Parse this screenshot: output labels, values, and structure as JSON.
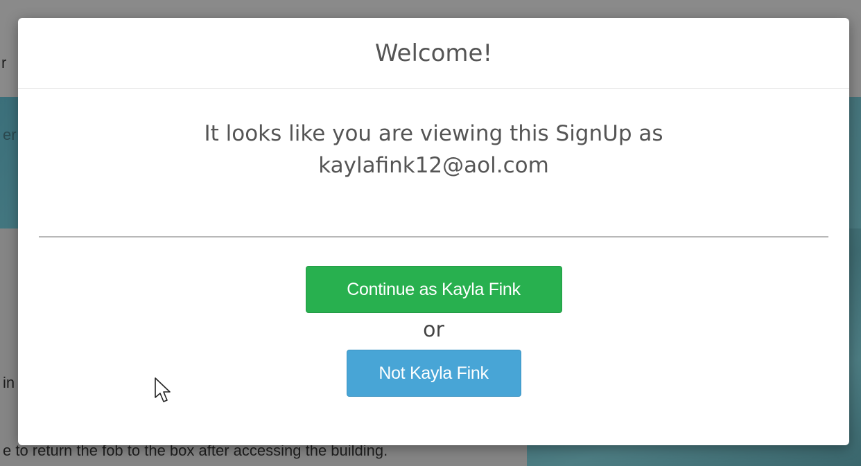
{
  "background": {
    "fragment_1": "r",
    "fragment_2": "er",
    "fragment_3": "in",
    "fragment_4": "e to return the fob to the box after accessing the building."
  },
  "modal": {
    "title": "Welcome!",
    "message_line_1": "It looks like you are viewing this SignUp as",
    "message_line_2": "kaylafink12@aol.com",
    "continue_label": "Continue as Kayla Fink",
    "or_label": "or",
    "not_label": "Not Kayla Fink"
  },
  "colors": {
    "continue_button": "#28b04f",
    "not_button": "#48a5d6"
  },
  "icons": {
    "cursor": "mouse-pointer-icon"
  }
}
